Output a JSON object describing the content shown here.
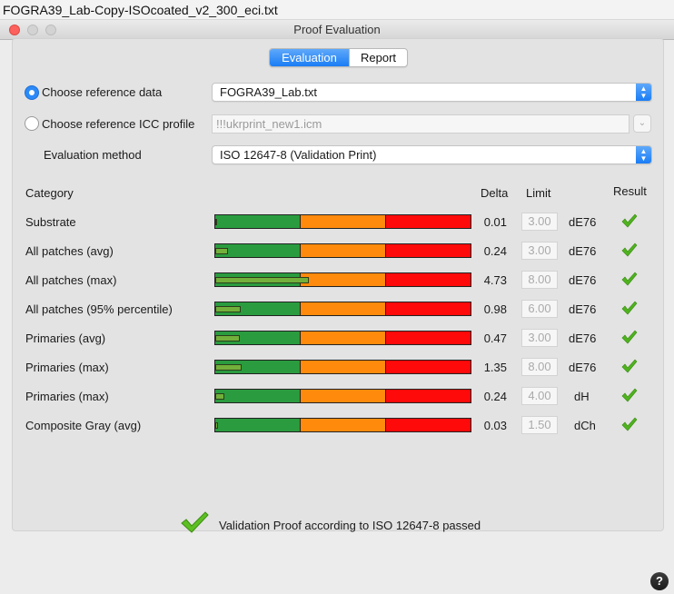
{
  "document_title": "FOGRA39_Lab-Copy-ISOcoated_v2_300_eci.txt",
  "window": {
    "title": "Proof Evaluation"
  },
  "tabs": [
    {
      "label": "Evaluation",
      "active": true
    },
    {
      "label": "Report",
      "active": false
    }
  ],
  "reference": {
    "data_option_label": "Choose reference data",
    "data_selected": true,
    "data_value": "FOGRA39_Lab.txt",
    "icc_option_label": "Choose reference ICC profile",
    "icc_selected": false,
    "icc_value": "!!!ukrprint_new1.icm"
  },
  "evaluation_method": {
    "label": "Evaluation method",
    "value": "ISO 12647-8 (Validation Print)"
  },
  "table_headers": {
    "category": "Category",
    "delta": "Delta",
    "limit": "Limit",
    "result": "Result"
  },
  "rows": [
    {
      "category": "Substrate",
      "delta": "0.01",
      "limit": "3.00",
      "unit": "dE76",
      "fill_fraction": 0.0033,
      "passed": true
    },
    {
      "category": "All patches (avg)",
      "delta": "0.24",
      "limit": "3.00",
      "unit": "dE76",
      "fill_fraction": 0.08,
      "passed": true
    },
    {
      "category": "All patches (max)",
      "delta": "4.73",
      "limit": "8.00",
      "unit": "dE76",
      "fill_fraction": 0.591,
      "passed": true
    },
    {
      "category": "All patches (95% percentile)",
      "delta": "0.98",
      "limit": "6.00",
      "unit": "dE76",
      "fill_fraction": 0.163,
      "passed": true
    },
    {
      "category": "Primaries (avg)",
      "delta": "0.47",
      "limit": "3.00",
      "unit": "dE76",
      "fill_fraction": 0.157,
      "passed": true
    },
    {
      "category": "Primaries (max)",
      "delta": "1.35",
      "limit": "8.00",
      "unit": "dE76",
      "fill_fraction": 0.169,
      "passed": true
    },
    {
      "category": "Primaries (max)",
      "delta": "0.24",
      "limit": "4.00",
      "unit": "dH",
      "fill_fraction": 0.06,
      "passed": true
    },
    {
      "category": "Composite Gray (avg)",
      "delta": "0.03",
      "limit": "1.50",
      "unit": "dCh",
      "fill_fraction": 0.02,
      "passed": true
    }
  ],
  "summary": {
    "text": "Validation Proof according to ISO 12647-8 passed",
    "passed": true
  },
  "help": {
    "label": "?"
  },
  "colors": {
    "green": "#2a9c3f",
    "orange": "#ff8a0c",
    "red": "#ff0a0a",
    "check": "#4fb31e",
    "accent": "#1a7df5"
  }
}
